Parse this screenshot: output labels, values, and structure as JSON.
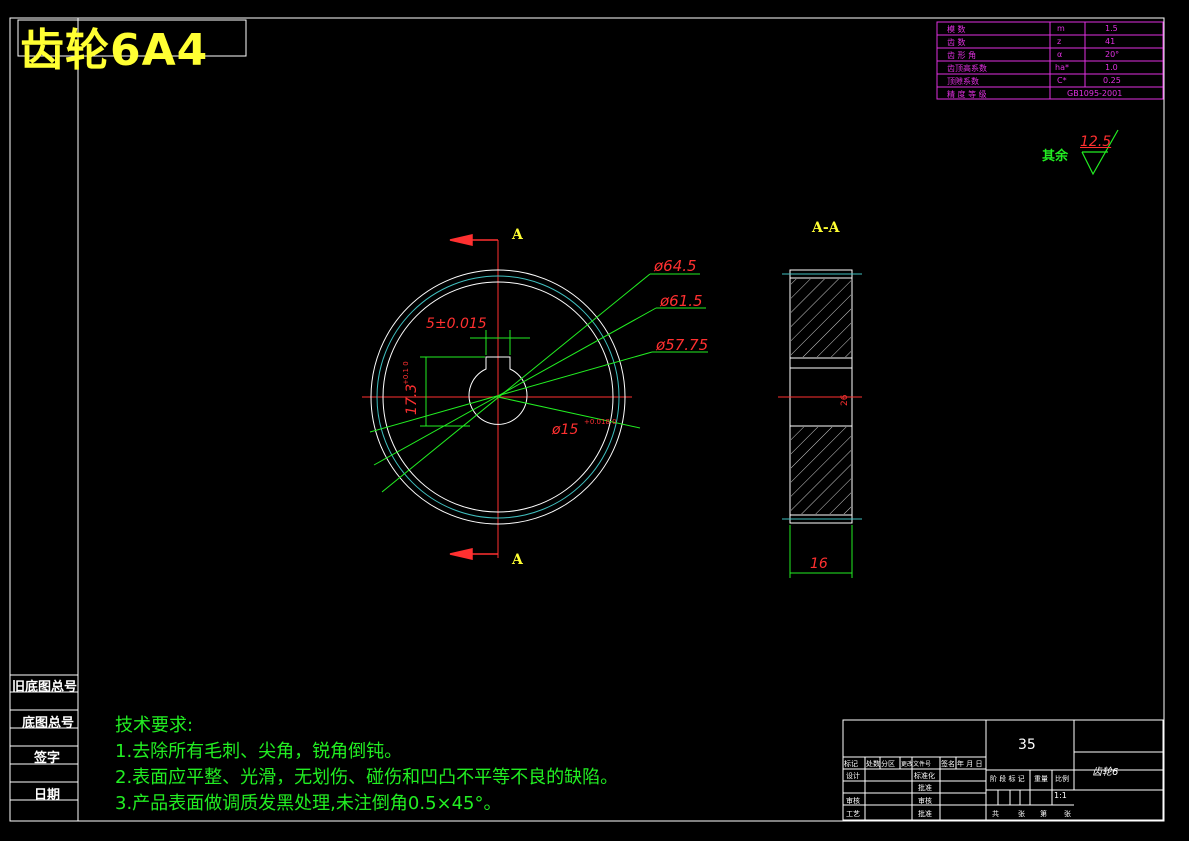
{
  "title": "齿轮6A4",
  "param_table": {
    "rows": [
      {
        "name": "模 数",
        "sym": "m",
        "val": "1.5"
      },
      {
        "name": "齿 数",
        "sym": "z",
        "val": "41"
      },
      {
        "name": "齿 形 角",
        "sym": "α",
        "val": "20°"
      },
      {
        "name": "齿顶高系数",
        "sym": "ha*",
        "val": "1.0"
      },
      {
        "name": "顶隙系数",
        "sym": "C*",
        "val": "0.25"
      },
      {
        "name": "精 度 等 级",
        "sym": "",
        "val": "GB1095-2001"
      }
    ]
  },
  "roughness": {
    "label": "其余",
    "value": "12.5"
  },
  "section_labels": {
    "top": "A",
    "bottom": "A",
    "view_title": "A-A"
  },
  "dimensions": {
    "d1": "ø64.5",
    "d2": "ø61.5",
    "d3": "ø57.75",
    "keyway_width": "5±0.015",
    "keyway_depth": "17.3",
    "keyway_depth_tol": "+0.1 0",
    "bore": "ø15",
    "bore_tol": "+0.018 0",
    "width": "16",
    "side_small": "26"
  },
  "left_labels": [
    "旧底图总号",
    "底图总号",
    "签字",
    "日期"
  ],
  "tech_requirements": {
    "heading": "技术要求:",
    "items": [
      "1.去除所有毛刺、尖角，锐角倒钝。",
      "2.表面应平整、光滑，无划伤、碰伤和凹凸不平等不良的缺陷。",
      "3.产品表面做调质发黑处理,未注倒角0.5×45°。"
    ]
  },
  "title_block": {
    "material_no": "35",
    "part_name": "齿轮6",
    "scale": "1:1",
    "header_cells": [
      "标记",
      "处数",
      "分区",
      "更改文件号",
      "签名",
      "年 月 日"
    ],
    "row_labels": [
      "设计",
      "审核",
      "工艺"
    ],
    "mid_labels": [
      "标准化",
      "批准",
      "审核",
      "批准"
    ],
    "right_header": [
      "阶 段 标 记",
      "重量",
      "比例"
    ],
    "bottom_row": [
      "共",
      "张",
      "第",
      "张"
    ]
  },
  "colors": {
    "frame": "#ffffff",
    "dimension": "#ff3030",
    "leader": "#22ee22",
    "title": "#ffff33",
    "table": "#e030e0",
    "center_line": "#ff3030",
    "gear_edge": "#ffffff",
    "pitch_line": "#40c0c0"
  }
}
